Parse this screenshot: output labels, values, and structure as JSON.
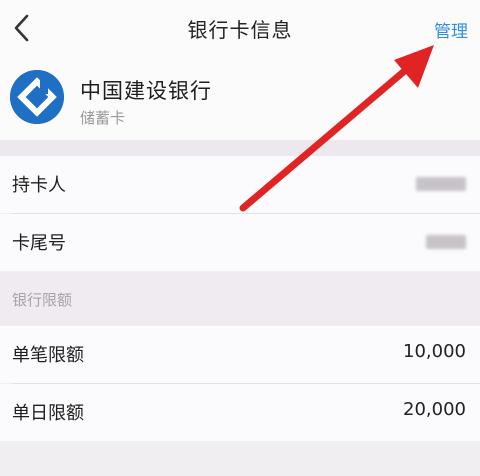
{
  "header": {
    "title": "银行卡信息",
    "manage_label": "管理"
  },
  "bank": {
    "name": "中国建设银行",
    "card_type": "储蓄卡",
    "logo_icon": "ccb-logo-icon"
  },
  "card_info": {
    "holder_label": "持卡人",
    "tail_label": "卡尾号"
  },
  "limits": {
    "section_title": "银行限额",
    "rows": [
      {
        "label": "单笔限额",
        "value": "10,000"
      },
      {
        "label": "单日限额",
        "value": "20,000"
      }
    ]
  },
  "colors": {
    "accent": "#2f8fe2",
    "bank_blue": "#1f6fc4",
    "annotation_red": "#e02424",
    "page_bg": "#f1eef2"
  }
}
